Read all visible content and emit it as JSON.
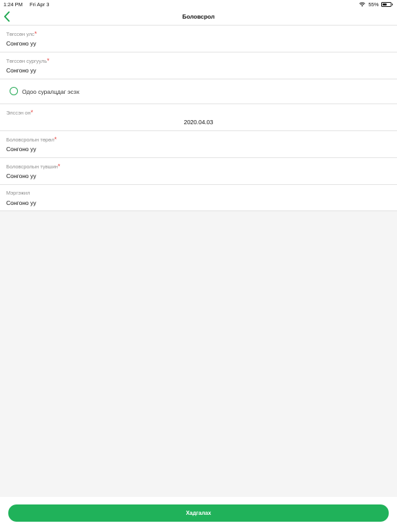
{
  "status_bar": {
    "time": "1:24 PM",
    "date": "Fri Apr 3",
    "battery": "55%",
    "battery_level": 0.55
  },
  "nav": {
    "title": "Боловсрол",
    "back_icon": "chevron-left-icon"
  },
  "form": {
    "country": {
      "label": "Төгссөн улс",
      "value": "Сонгоно уу",
      "required_mark": "*"
    },
    "school": {
      "label": "Төгссөн сургууль",
      "value": "Сонгоно уу",
      "required_mark": "*"
    },
    "currently_studying": {
      "label": "Одоо суралцдаг эсэх",
      "checked": false
    },
    "enroll_year": {
      "label": "Элссэн он",
      "value": "2020.04.03",
      "required_mark": "*"
    },
    "education_type": {
      "label": "Боловсролын төрөл",
      "value": "Сонгоно уу",
      "required_mark": "*"
    },
    "education_level": {
      "label": "Боловсролын түвшин",
      "value": "Сонгоно уу",
      "required_mark": "*"
    },
    "profession": {
      "label": "Мэргэжил",
      "value": "Сонгоно уу"
    }
  },
  "actions": {
    "save_label": "Хадгалах"
  },
  "colors": {
    "accent": "#20b25a",
    "required": "#e53935",
    "label": "#8e8e8e",
    "background": "#f5f5f5"
  }
}
